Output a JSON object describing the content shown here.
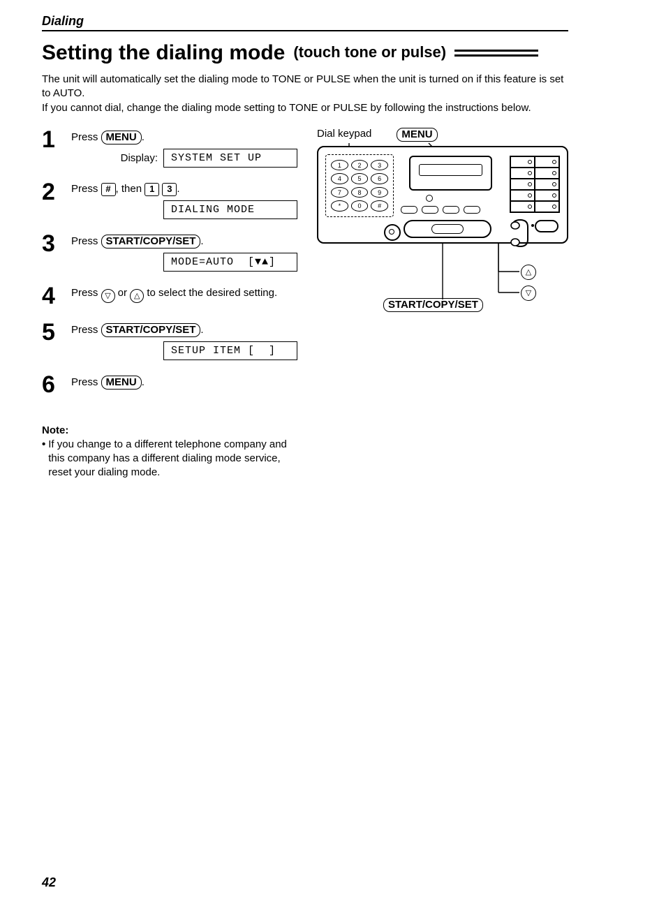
{
  "section": "Dialing",
  "title_main": "Setting the dialing mode",
  "title_sub": "(touch tone or pulse)",
  "intro": "The unit will automatically set the dialing mode to TONE or PULSE when the unit is turned on if this feature is set to AUTO.\nIf you cannot dial, change the dialing mode setting to TONE or PULSE by following the instructions below.",
  "steps": [
    {
      "num": "1",
      "pre": "Press ",
      "button": "MENU",
      "post": ".",
      "display_label": "Display:",
      "lcd": "SYSTEM SET UP"
    },
    {
      "num": "2",
      "pre": "Press ",
      "key1": "#",
      "mid": ", then ",
      "key2": "1",
      "key3": "3",
      "post": ".",
      "lcd": "DIALING MODE"
    },
    {
      "num": "3",
      "pre": "Press ",
      "button": "START/COPY/SET",
      "post": ".",
      "lcd": "MODE=AUTO  [▼▲]"
    },
    {
      "num": "4",
      "pre": "Press ",
      "circ1": "▽",
      "mid": " or ",
      "circ2": "△",
      "post": " to select the desired setting."
    },
    {
      "num": "5",
      "pre": "Press ",
      "button": "START/COPY/SET",
      "post": ".",
      "lcd": "SETUP ITEM [  ]"
    },
    {
      "num": "6",
      "pre": "Press ",
      "button": "MENU",
      "post": "."
    }
  ],
  "panel": {
    "label_keypad": "Dial keypad",
    "label_menu": "MENU",
    "keys": [
      "1",
      "2",
      "3",
      "4",
      "5",
      "6",
      "7",
      "8",
      "9",
      "*",
      "0",
      "#"
    ],
    "callout_startcopyset": "START/COPY/SET",
    "arrow_up": "△",
    "arrow_down": "▽"
  },
  "note": {
    "title": "Note:",
    "bullet": "•",
    "text": "If you change to a different telephone company and this company has a different dialing mode service, reset your dialing mode."
  },
  "page_number": "42"
}
